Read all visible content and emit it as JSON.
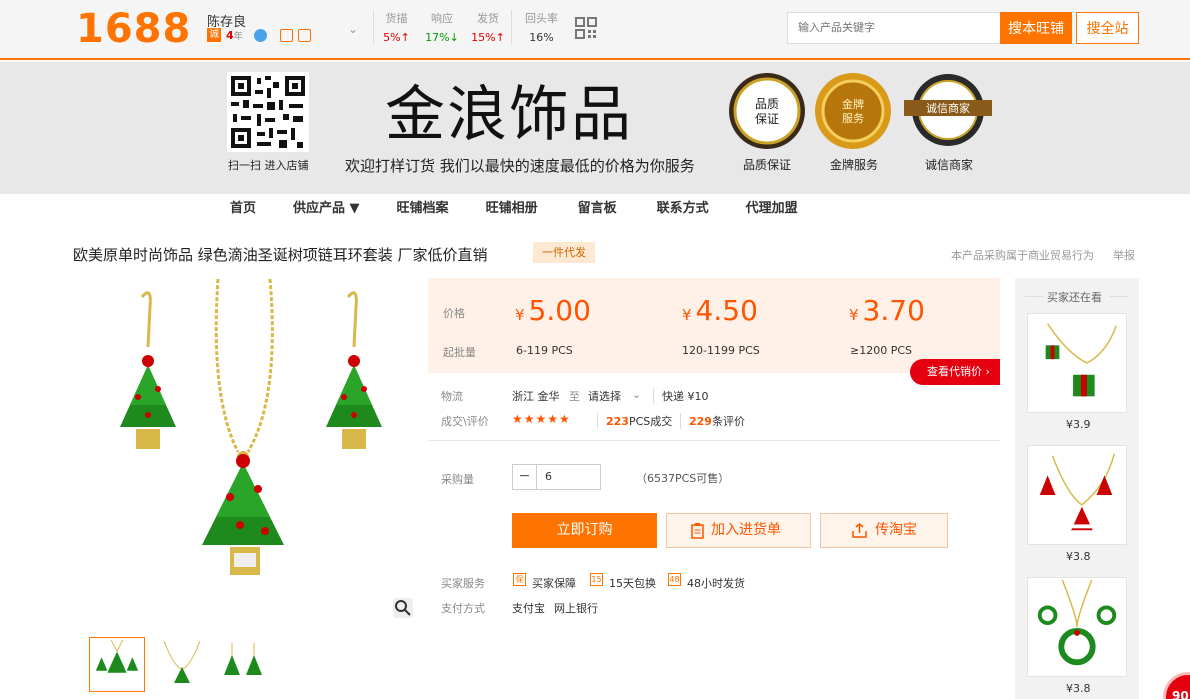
{
  "topbar": {
    "logo": "1688",
    "seller_name": "陈存良",
    "badge_cheng": "诚",
    "years_num": "4",
    "years_unit": "年",
    "stats": [
      {
        "label": "货描",
        "value": "5%↑"
      },
      {
        "label": "响应",
        "value": "17%↓"
      },
      {
        "label": "发货",
        "value": "15%↑"
      },
      {
        "label": "回头率",
        "value": "16%"
      }
    ],
    "search_placeholder": "输入产品关键字",
    "search_shop_label": "搜本旺铺",
    "search_all_label": "搜全站"
  },
  "banner": {
    "qr_caption": "扫一扫 进入店铺",
    "shop_title": "金浪饰品",
    "slogan": "欢迎打样订货 我们以最快的速度最低的价格为你服务",
    "seals": [
      {
        "label": "品质保证",
        "seal_text": "品质保证"
      },
      {
        "label": "金牌服务",
        "seal_text": "金牌服务"
      },
      {
        "label": "诚信商家",
        "seal_text": "诚信商家"
      }
    ]
  },
  "nav": [
    "首页",
    "供应产品 ▼",
    "旺铺档案",
    "旺铺相册",
    "留言板",
    "联系方式",
    "代理加盟"
  ],
  "product": {
    "title": "欧美原单时尚饰品 绿色滴油圣诞树项链耳环套装 厂家低价直销",
    "tag": "一件代发",
    "legal_note": "本产品采购属于商业贸易行为",
    "report": "举报"
  },
  "pricing": {
    "price_label": "价格",
    "min_qty_label": "起批量",
    "currency": "¥",
    "tiers": [
      {
        "price": "5.00",
        "range": "6-119 PCS"
      },
      {
        "price": "4.50",
        "range": "120-1199 PCS"
      },
      {
        "price": "3.70",
        "range": "≥1200 PCS"
      }
    ],
    "agent_price": "查看代销价 ›"
  },
  "logistics": {
    "label": "物流",
    "from": "浙江 金华",
    "to_label": "至",
    "select": "请选择",
    "express": "快递 ¥10"
  },
  "deals": {
    "label": "成交\\评价",
    "stars": "★★★★★",
    "count": "223",
    "count_unit": "PCS成交",
    "reviews": "229",
    "reviews_unit": "条评价"
  },
  "purchase": {
    "label": "采购量",
    "minus": "−",
    "quantity": "6",
    "stock": "（6537PCS可售）",
    "order_btn": "立即订购",
    "cart_btn": "加入进货单",
    "taobao_btn": "传淘宝"
  },
  "services": {
    "label": "买家服务",
    "items": [
      {
        "icon": "保",
        "text": "买家保障"
      },
      {
        "icon": "15",
        "text": "15天包换"
      },
      {
        "icon": "48",
        "text": "48小时发货"
      }
    ]
  },
  "payment": {
    "label": "支付方式",
    "methods": [
      "支付宝",
      "网上银行"
    ]
  },
  "sidebar": {
    "title": "买家还在看",
    "items": [
      {
        "price": "¥3.9"
      },
      {
        "price": "¥3.8"
      },
      {
        "price": "¥3.8"
      }
    ]
  },
  "float_badge": "90"
}
